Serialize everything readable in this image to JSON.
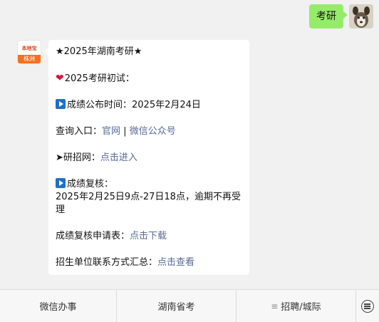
{
  "user_message": {
    "text": "考研"
  },
  "bot": {
    "avatar_top": "本地宝",
    "avatar_bottom": "株洲"
  },
  "message": {
    "title": "★2025年湖南考研★",
    "section1_label": "2025考研初试：",
    "score_time": "成绩公布时间：2025年2月24日",
    "query_label": "查询入口：",
    "query_link1": "官网",
    "query_sep": " | ",
    "query_link2": "微信公众号",
    "yzw_label": "➤研招网：",
    "yzw_link": "点击进入",
    "recheck_label": "成绩复核：",
    "recheck_time": "2025年2月25日9点-27日18点，逾期不再受",
    "recheck_time2": "理",
    "form_label": "成绩复核申请表：",
    "form_link": "点击下载",
    "contact_label": "招生单位联系方式汇总：",
    "contact_link": "点击查看"
  },
  "menu": {
    "item1": "微信办事",
    "item2": "湖南省考",
    "item3": "招聘/城际",
    "item3_icon": "≡"
  }
}
